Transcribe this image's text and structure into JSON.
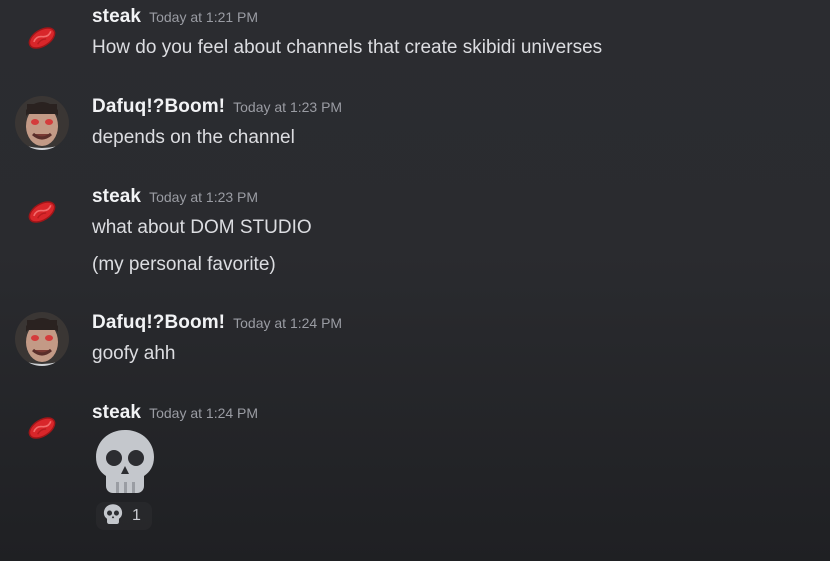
{
  "messages": [
    {
      "author": "steak",
      "avatar_icon": "steak-icon",
      "timestamp": "Today at 1:21 PM",
      "lines": [
        "How do you feel about channels that create skibidi universes"
      ]
    },
    {
      "author": "Dafuq!?Boom!",
      "avatar_icon": "skibidi-toilet-face-avatar",
      "timestamp": "Today at 1:23 PM",
      "lines": [
        "depends on the channel"
      ]
    },
    {
      "author": "steak",
      "avatar_icon": "steak-icon",
      "timestamp": "Today at 1:23 PM",
      "lines": [
        "what about DOM STUDIO",
        "(my personal favorite)"
      ]
    },
    {
      "author": "Dafuq!?Boom!",
      "avatar_icon": "skibidi-toilet-face-avatar",
      "timestamp": "Today at 1:24 PM",
      "lines": [
        "goofy ahh"
      ]
    },
    {
      "author": "steak",
      "avatar_icon": "steak-icon",
      "timestamp": "Today at 1:24 PM",
      "emoji": "skull-emoji",
      "reaction": {
        "emoji": "skull-emoji",
        "count": "1"
      }
    }
  ],
  "colors": {
    "background": "#2b2c30",
    "username": "#f2f3f5",
    "timestamp": "#9a9ca3",
    "message_text": "#dcdde1",
    "steak_red": "#d8262a"
  }
}
